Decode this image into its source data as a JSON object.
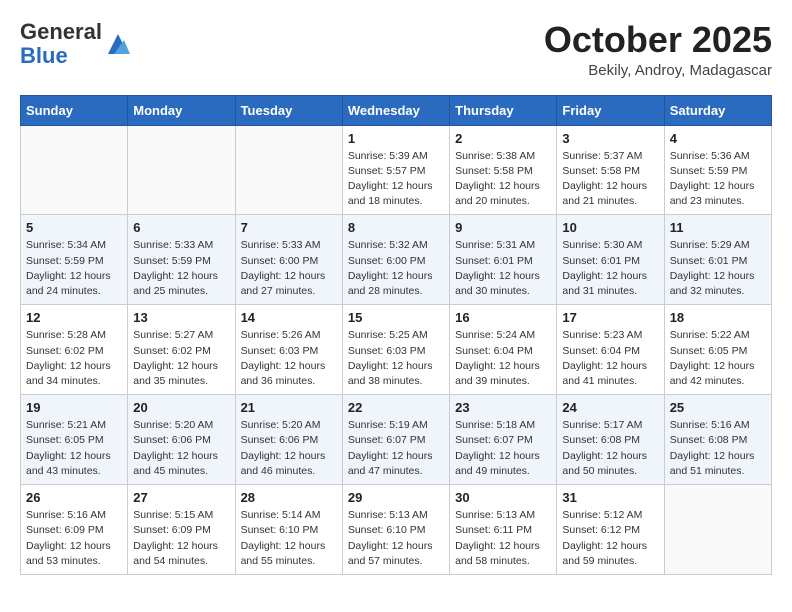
{
  "header": {
    "logo_general": "General",
    "logo_blue": "Blue",
    "month_title": "October 2025",
    "subtitle": "Bekily, Androy, Madagascar"
  },
  "days_of_week": [
    "Sunday",
    "Monday",
    "Tuesday",
    "Wednesday",
    "Thursday",
    "Friday",
    "Saturday"
  ],
  "weeks": [
    [
      {
        "day": "",
        "info": ""
      },
      {
        "day": "",
        "info": ""
      },
      {
        "day": "",
        "info": ""
      },
      {
        "day": "1",
        "info": "Sunrise: 5:39 AM\nSunset: 5:57 PM\nDaylight: 12 hours\nand 18 minutes."
      },
      {
        "day": "2",
        "info": "Sunrise: 5:38 AM\nSunset: 5:58 PM\nDaylight: 12 hours\nand 20 minutes."
      },
      {
        "day": "3",
        "info": "Sunrise: 5:37 AM\nSunset: 5:58 PM\nDaylight: 12 hours\nand 21 minutes."
      },
      {
        "day": "4",
        "info": "Sunrise: 5:36 AM\nSunset: 5:59 PM\nDaylight: 12 hours\nand 23 minutes."
      }
    ],
    [
      {
        "day": "5",
        "info": "Sunrise: 5:34 AM\nSunset: 5:59 PM\nDaylight: 12 hours\nand 24 minutes."
      },
      {
        "day": "6",
        "info": "Sunrise: 5:33 AM\nSunset: 5:59 PM\nDaylight: 12 hours\nand 25 minutes."
      },
      {
        "day": "7",
        "info": "Sunrise: 5:33 AM\nSunset: 6:00 PM\nDaylight: 12 hours\nand 27 minutes."
      },
      {
        "day": "8",
        "info": "Sunrise: 5:32 AM\nSunset: 6:00 PM\nDaylight: 12 hours\nand 28 minutes."
      },
      {
        "day": "9",
        "info": "Sunrise: 5:31 AM\nSunset: 6:01 PM\nDaylight: 12 hours\nand 30 minutes."
      },
      {
        "day": "10",
        "info": "Sunrise: 5:30 AM\nSunset: 6:01 PM\nDaylight: 12 hours\nand 31 minutes."
      },
      {
        "day": "11",
        "info": "Sunrise: 5:29 AM\nSunset: 6:01 PM\nDaylight: 12 hours\nand 32 minutes."
      }
    ],
    [
      {
        "day": "12",
        "info": "Sunrise: 5:28 AM\nSunset: 6:02 PM\nDaylight: 12 hours\nand 34 minutes."
      },
      {
        "day": "13",
        "info": "Sunrise: 5:27 AM\nSunset: 6:02 PM\nDaylight: 12 hours\nand 35 minutes."
      },
      {
        "day": "14",
        "info": "Sunrise: 5:26 AM\nSunset: 6:03 PM\nDaylight: 12 hours\nand 36 minutes."
      },
      {
        "day": "15",
        "info": "Sunrise: 5:25 AM\nSunset: 6:03 PM\nDaylight: 12 hours\nand 38 minutes."
      },
      {
        "day": "16",
        "info": "Sunrise: 5:24 AM\nSunset: 6:04 PM\nDaylight: 12 hours\nand 39 minutes."
      },
      {
        "day": "17",
        "info": "Sunrise: 5:23 AM\nSunset: 6:04 PM\nDaylight: 12 hours\nand 41 minutes."
      },
      {
        "day": "18",
        "info": "Sunrise: 5:22 AM\nSunset: 6:05 PM\nDaylight: 12 hours\nand 42 minutes."
      }
    ],
    [
      {
        "day": "19",
        "info": "Sunrise: 5:21 AM\nSunset: 6:05 PM\nDaylight: 12 hours\nand 43 minutes."
      },
      {
        "day": "20",
        "info": "Sunrise: 5:20 AM\nSunset: 6:06 PM\nDaylight: 12 hours\nand 45 minutes."
      },
      {
        "day": "21",
        "info": "Sunrise: 5:20 AM\nSunset: 6:06 PM\nDaylight: 12 hours\nand 46 minutes."
      },
      {
        "day": "22",
        "info": "Sunrise: 5:19 AM\nSunset: 6:07 PM\nDaylight: 12 hours\nand 47 minutes."
      },
      {
        "day": "23",
        "info": "Sunrise: 5:18 AM\nSunset: 6:07 PM\nDaylight: 12 hours\nand 49 minutes."
      },
      {
        "day": "24",
        "info": "Sunrise: 5:17 AM\nSunset: 6:08 PM\nDaylight: 12 hours\nand 50 minutes."
      },
      {
        "day": "25",
        "info": "Sunrise: 5:16 AM\nSunset: 6:08 PM\nDaylight: 12 hours\nand 51 minutes."
      }
    ],
    [
      {
        "day": "26",
        "info": "Sunrise: 5:16 AM\nSunset: 6:09 PM\nDaylight: 12 hours\nand 53 minutes."
      },
      {
        "day": "27",
        "info": "Sunrise: 5:15 AM\nSunset: 6:09 PM\nDaylight: 12 hours\nand 54 minutes."
      },
      {
        "day": "28",
        "info": "Sunrise: 5:14 AM\nSunset: 6:10 PM\nDaylight: 12 hours\nand 55 minutes."
      },
      {
        "day": "29",
        "info": "Sunrise: 5:13 AM\nSunset: 6:10 PM\nDaylight: 12 hours\nand 57 minutes."
      },
      {
        "day": "30",
        "info": "Sunrise: 5:13 AM\nSunset: 6:11 PM\nDaylight: 12 hours\nand 58 minutes."
      },
      {
        "day": "31",
        "info": "Sunrise: 5:12 AM\nSunset: 6:12 PM\nDaylight: 12 hours\nand 59 minutes."
      },
      {
        "day": "",
        "info": ""
      }
    ]
  ]
}
